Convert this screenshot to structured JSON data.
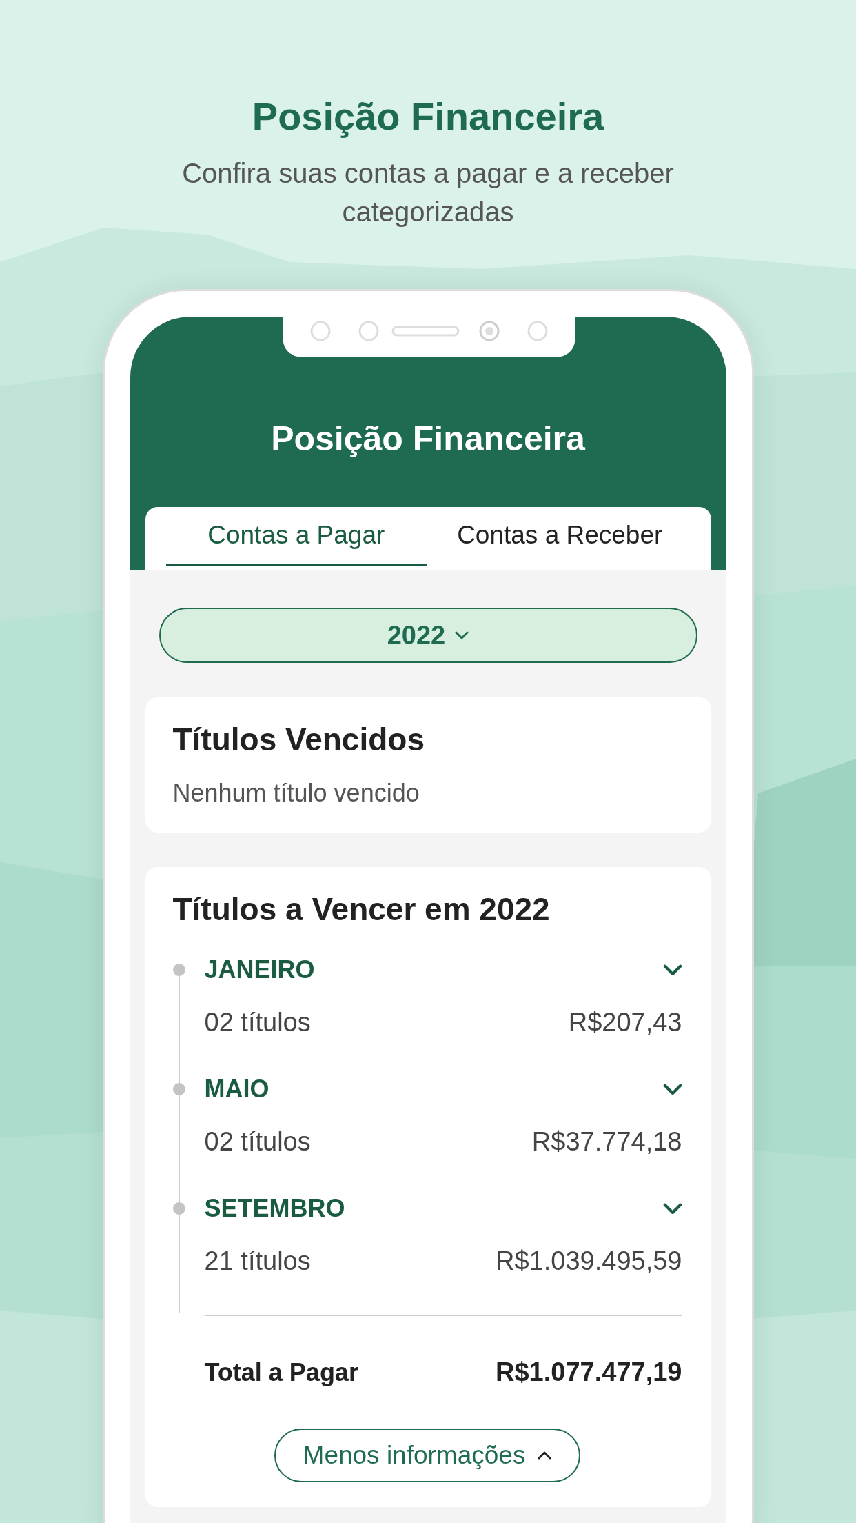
{
  "headline": "Posição Financeira",
  "subtitle": "Confira suas contas a pagar e a receber categorizadas",
  "app": {
    "title": "Posição Financeira",
    "tabs": [
      {
        "label": "Contas a Pagar",
        "selected": true
      },
      {
        "label": "Contas a Receber",
        "selected": false
      }
    ],
    "year_selector": {
      "value": "2022"
    },
    "overdue": {
      "title": "Títulos Vencidos",
      "message": "Nenhum título vencido"
    },
    "upcoming": {
      "title": "Títulos a Vencer em 2022",
      "months": [
        {
          "name": "JANEIRO",
          "count": "02 títulos",
          "amount": "R$207,43",
          "expanded": false
        },
        {
          "name": "MAIO",
          "count": "02 títulos",
          "amount": "R$37.774,18",
          "expanded": false
        },
        {
          "name": "SETEMBRO",
          "count": "21 títulos",
          "amount": "R$1.039.495,59",
          "expanded": false
        }
      ],
      "total_label": "Total a Pagar",
      "total_value": "R$1.077.477,19",
      "toggle_button": "Menos informações"
    }
  }
}
